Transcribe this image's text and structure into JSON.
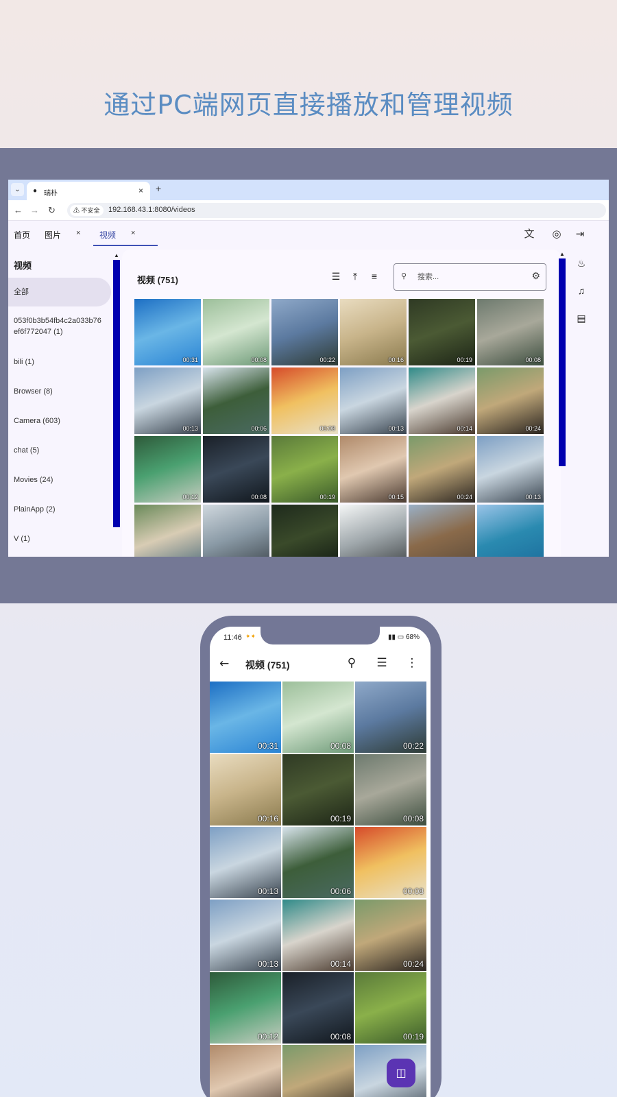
{
  "headline": "通过PC端网页直接播放和管理视频",
  "browser": {
    "tab_title": "瑞朴",
    "tab_close": "×",
    "tab_new": "+",
    "insecure_label": "不安全",
    "url": "192.168.43.1:8080/videos",
    "app_tabs": [
      {
        "label": "首页"
      },
      {
        "label": "图片",
        "close": "×"
      },
      {
        "label": "视频",
        "close": "×"
      }
    ],
    "sidebar": {
      "title": "视频",
      "items": [
        {
          "label": "全部"
        },
        {
          "label": "053f0b3b54fb4c2a033b76ef6f772047 (1)"
        },
        {
          "label": "bili (1)"
        },
        {
          "label": "Browser (8)"
        },
        {
          "label": "Camera (603)"
        },
        {
          "label": "chat (5)"
        },
        {
          "label": "Movies (24)"
        },
        {
          "label": "PlainApp (2)"
        },
        {
          "label": "V (1)"
        }
      ]
    },
    "main": {
      "title": "视频 (751)",
      "search_placeholder": "搜索..."
    },
    "videos": [
      {
        "duration": "00:31",
        "colors": [
          "#1d6fc4",
          "#6ab6e6",
          "#2a84d4"
        ]
      },
      {
        "duration": "00:08",
        "colors": [
          "#9cbf9a",
          "#d4e6d0",
          "#6e9a78"
        ]
      },
      {
        "duration": "00:22",
        "colors": [
          "#8fa9c9",
          "#5c7aa0",
          "#2e3b35"
        ]
      },
      {
        "duration": "00:16",
        "colors": [
          "#e9dcc0",
          "#c8b48a",
          "#8a7a4e"
        ]
      },
      {
        "duration": "00:19",
        "colors": [
          "#2f3a24",
          "#4b5a34",
          "#1c2416"
        ]
      },
      {
        "duration": "00:08",
        "colors": [
          "#6d7a6e",
          "#a8a89a",
          "#3c4d3e"
        ]
      },
      {
        "duration": "00:13",
        "colors": [
          "#7d9fc4",
          "#c9d6e0",
          "#3a4550"
        ]
      },
      {
        "duration": "00:06",
        "colors": [
          "#d8e4ec",
          "#3d5e3a",
          "#4a6a62"
        ]
      },
      {
        "duration": "00:08",
        "colors": [
          "#d64a2a",
          "#f0c060",
          "#e8e0c8"
        ]
      },
      {
        "duration": "00:13",
        "colors": [
          "#7d9fc4",
          "#c9d6e0",
          "#3a4550"
        ]
      },
      {
        "duration": "00:14",
        "colors": [
          "#2f8a88",
          "#d8d4cc",
          "#4a3a2e"
        ]
      },
      {
        "duration": "00:24",
        "colors": [
          "#7a9a6a",
          "#c0a87a",
          "#2a2420"
        ]
      },
      {
        "duration": "00:12",
        "colors": [
          "#2e5a3a",
          "#4aa070",
          "#c8ccc0"
        ]
      },
      {
        "duration": "00:08",
        "colors": [
          "#1a2028",
          "#3a4858",
          "#10161c"
        ]
      },
      {
        "duration": "00:19",
        "colors": [
          "#5a7a3a",
          "#8ab04a",
          "#3a5a2a"
        ]
      },
      {
        "duration": "00:15",
        "colors": [
          "#b08a6a",
          "#e0c8b0",
          "#4a3a30"
        ]
      },
      {
        "duration": "00:24",
        "colors": [
          "#7a9a6a",
          "#c0a87a",
          "#2a2420"
        ]
      },
      {
        "duration": "00:13",
        "colors": [
          "#7d9fc4",
          "#c9d6e0",
          "#3a4550"
        ]
      },
      {
        "duration": "",
        "colors": [
          "#6a8a5a",
          "#d8ccb4",
          "#4a6a7a"
        ]
      },
      {
        "duration": "",
        "colors": [
          "#d0d8de",
          "#8a9aa6",
          "#3a4248"
        ]
      },
      {
        "duration": "",
        "colors": [
          "#1e2a1c",
          "#3a4a2a",
          "#0e1610"
        ]
      },
      {
        "duration": "",
        "colors": [
          "#f4f6f6",
          "#a0a8ac",
          "#3a3e40"
        ]
      },
      {
        "duration": "",
        "colors": [
          "#9ab0c6",
          "#8a6a4a",
          "#5a4a3a"
        ]
      },
      {
        "duration": "",
        "colors": [
          "#9ac4e8",
          "#2a8ab0",
          "#1a6a9a"
        ]
      }
    ]
  },
  "phone": {
    "time": "11:46",
    "battery": "68%",
    "title": "视频 (751)",
    "videos": [
      {
        "duration": "00:31",
        "colors": [
          "#1d6fc4",
          "#6ab6e6",
          "#2a84d4"
        ]
      },
      {
        "duration": "00:08",
        "colors": [
          "#9cbf9a",
          "#d4e6d0",
          "#6e9a78"
        ]
      },
      {
        "duration": "00:22",
        "colors": [
          "#8fa9c9",
          "#5c7aa0",
          "#2e3b35"
        ]
      },
      {
        "duration": "00:16",
        "colors": [
          "#e9dcc0",
          "#c8b48a",
          "#8a7a4e"
        ]
      },
      {
        "duration": "00:19",
        "colors": [
          "#2f3a24",
          "#4b5a34",
          "#1c2416"
        ]
      },
      {
        "duration": "00:08",
        "colors": [
          "#6d7a6e",
          "#a8a89a",
          "#3c4d3e"
        ]
      },
      {
        "duration": "00:13",
        "colors": [
          "#7d9fc4",
          "#c9d6e0",
          "#3a4550"
        ]
      },
      {
        "duration": "00:06",
        "colors": [
          "#d8e4ec",
          "#3d5e3a",
          "#4a6a62"
        ]
      },
      {
        "duration": "00:08",
        "colors": [
          "#d64a2a",
          "#f0c060",
          "#e8e0c8"
        ]
      },
      {
        "duration": "00:13",
        "colors": [
          "#7d9fc4",
          "#c9d6e0",
          "#3a4550"
        ]
      },
      {
        "duration": "00:14",
        "colors": [
          "#2f8a88",
          "#d8d4cc",
          "#4a3a2e"
        ]
      },
      {
        "duration": "00:24",
        "colors": [
          "#7a9a6a",
          "#c0a87a",
          "#2a2420"
        ]
      },
      {
        "duration": "00:12",
        "colors": [
          "#2e5a3a",
          "#4aa070",
          "#c8ccc0"
        ]
      },
      {
        "duration": "00:08",
        "colors": [
          "#1a2028",
          "#3a4858",
          "#10161c"
        ]
      },
      {
        "duration": "00:19",
        "colors": [
          "#5a7a3a",
          "#8ab04a",
          "#3a5a2a"
        ]
      },
      {
        "duration": "",
        "colors": [
          "#b08a6a",
          "#e0c8b0",
          "#4a3a30"
        ]
      },
      {
        "duration": "",
        "colors": [
          "#7a9a6a",
          "#c0a87a",
          "#2a2420"
        ]
      },
      {
        "duration": "",
        "colors": [
          "#7d9fc4",
          "#c9d6e0",
          "#3a4550"
        ]
      }
    ]
  },
  "icons": {
    "translate": "translate-icon",
    "palette": "palette-icon",
    "logout": "logout-icon",
    "notifications": "bell-icon",
    "playlist": "playlist-icon",
    "chat": "chat-icon",
    "list_view": "list-view-icon",
    "upload": "upload-icon",
    "sort": "sort-icon",
    "search": "search-icon",
    "filter": "tune-icon",
    "fab": "cast-icon"
  },
  "colors": {
    "accent": "#3f51b5",
    "scrollbar": "#0000b0",
    "headline": "#5a8cc2",
    "fab": "#5b34b3"
  }
}
